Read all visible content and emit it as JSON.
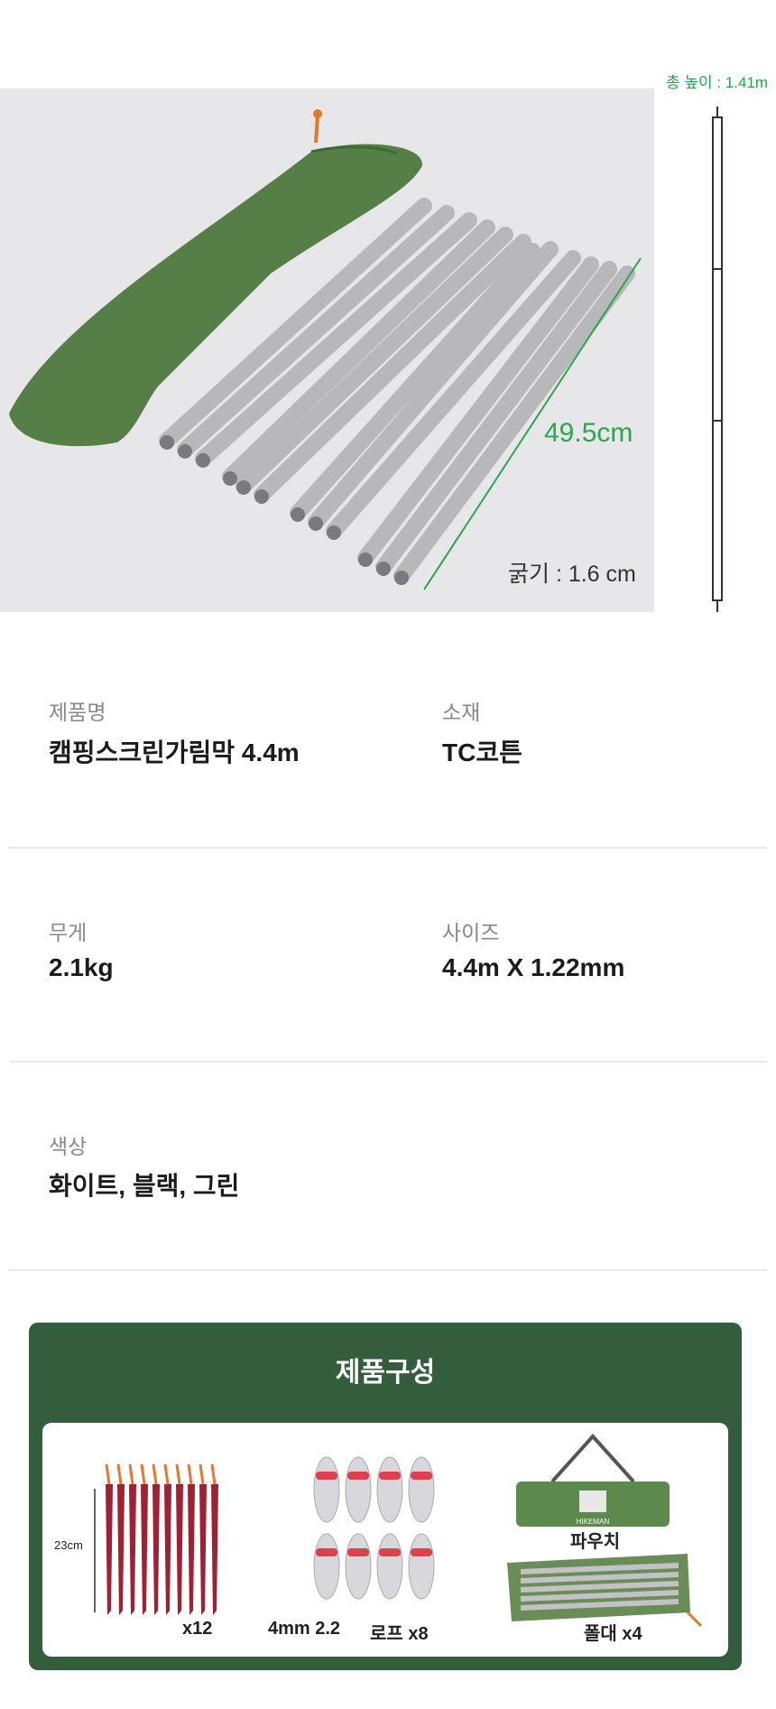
{
  "photo": {
    "height_label": "총 높이 : 1.41m",
    "length_label": "49.5cm",
    "thickness_label": "굵기 : 1.6 cm"
  },
  "specs": [
    {
      "label": "제품명",
      "value": "캠핑스크린가림막 4.4m"
    },
    {
      "label": "소재",
      "value": "TC코튼"
    },
    {
      "label": "무게",
      "value": "2.1kg"
    },
    {
      "label": "사이즈",
      "value": "4.4m X 1.22mm"
    },
    {
      "label": "색상",
      "value": "화이트, 블랙, 그린"
    }
  ],
  "components": {
    "title": "제품구성",
    "pegs": {
      "height_label": "23cm",
      "count_label": "x12"
    },
    "rope": {
      "spec_label": "4mm 2.2",
      "count_label": "로프 x8"
    },
    "pouch": {
      "label": "파우치",
      "brand": "HIKEMAN"
    },
    "pole": {
      "count_label": "폴대 x4"
    }
  },
  "colors": {
    "accent_green": "#27a84a",
    "panel_green": "#335d3c",
    "peg_red": "#a02034",
    "bag_green": "#4e7d43"
  }
}
